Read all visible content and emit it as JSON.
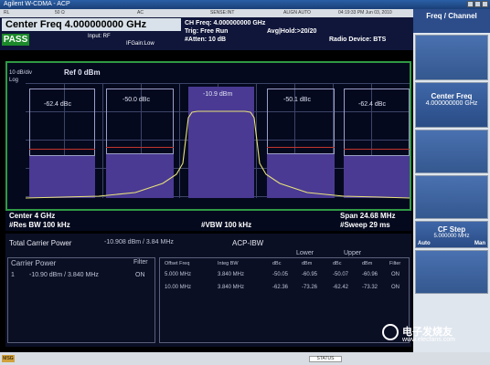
{
  "window": {
    "title": "Agilent W-CDMA - ACP"
  },
  "status_row": [
    "RL",
    "50 Ω",
    "AC",
    "SENSE:INT",
    "ALIGN AUTO",
    "04:19:33 PM Jun 03, 2010"
  ],
  "header": {
    "center_freq": "Center Freq  4.000000000 GHz",
    "pass_label": "PASS",
    "input": "Input: RF",
    "if_gain": "IFGain:Low",
    "ch_freq": "CH Freq: 4.000000000 GHz",
    "trig": "Trig: Free Run",
    "avg_hold": "Avg|Hold:>20/20",
    "atten": "#Atten: 10 dB",
    "radio_device": "Radio Device: BTS"
  },
  "plot": {
    "scale": "10 dB/div",
    "log_label": "Log",
    "ref": "Ref  0 dBm",
    "labels": [
      "-62.4 dBc",
      "-50.0 dBc",
      "-10.9 dBm",
      "-50.1 dBc",
      "-62.4 dBc"
    ],
    "center": "Center  4 GHz",
    "span": "Span 24.68 MHz",
    "res_bw": "#Res BW  100 kHz",
    "vbw": "#VBW  100 kHz",
    "sweep": "#Sweep  29 ms"
  },
  "results": {
    "total_carrier_power_label": "Total Carrier Power",
    "total_carrier_power_value": "-10.908 dBm / 3.84 MHz",
    "mode": "ACP-IBW",
    "carrier_power_label": "Carrier Power",
    "filter_label": "Filter",
    "carrier_row": [
      "1",
      "-10.90 dBm / 3.840 MHz",
      "ON"
    ],
    "lower": "Lower",
    "upper": "Upper",
    "columns": [
      "Offset Freq",
      "Integ BW",
      "dBc",
      "dBm",
      "dBc",
      "dBm",
      "Filter"
    ],
    "rows": [
      [
        "5.000 MHz",
        "3.840 MHz",
        "-50.05",
        "-60.95",
        "-50.07",
        "-60.96",
        "ON"
      ],
      [
        "10.00 MHz",
        "3.840 MHz",
        "-62.36",
        "-73.26",
        "-62.42",
        "-73.32",
        "ON"
      ]
    ]
  },
  "sidebar": {
    "title": "Freq / Channel",
    "btn_center": {
      "label": "Center Freq",
      "value": "4.000000000 GHz"
    },
    "btn_cfstep": {
      "label": "CF Step",
      "value": "5.000000 MHz",
      "auto": "Auto",
      "man": "Man"
    }
  },
  "bottom": {
    "msg": "MSG",
    "status": "STATUS"
  },
  "watermark": {
    "cn": "电子发烧友",
    "url": "www.elecfans.com"
  }
}
